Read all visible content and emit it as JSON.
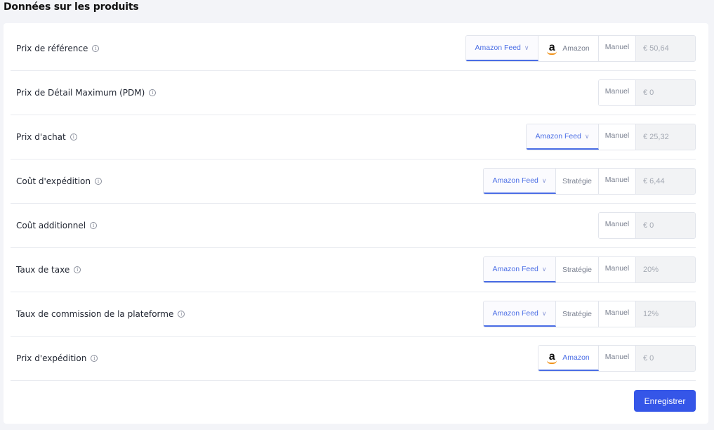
{
  "section_title": "Données sur les produits",
  "source_labels": {
    "amazon_feed": "Amazon Feed",
    "amazon": "Amazon",
    "strategie": "Stratégie",
    "manuel": "Manuel"
  },
  "rows": [
    {
      "label": "Prix de référence",
      "value": "€ 50,64"
    },
    {
      "label": "Prix de Détail Maximum (PDM)",
      "value": "€ 0"
    },
    {
      "label": "Prix d'achat",
      "value": "€ 25,32"
    },
    {
      "label": "Coût d'expédition",
      "value": "€ 6,44"
    },
    {
      "label": "Coût additionnel",
      "value": "€ 0"
    },
    {
      "label": "Taux de taxe",
      "value": "20%"
    },
    {
      "label": "Taux de commission de la plateforme",
      "value": "12%"
    },
    {
      "label": "Prix d'expédition",
      "value": "€ 0"
    }
  ],
  "save_label": "Enregistrer",
  "colors": {
    "accent": "#3556e8",
    "link": "#4a6de5",
    "amazon_orange": "#f0931b"
  }
}
